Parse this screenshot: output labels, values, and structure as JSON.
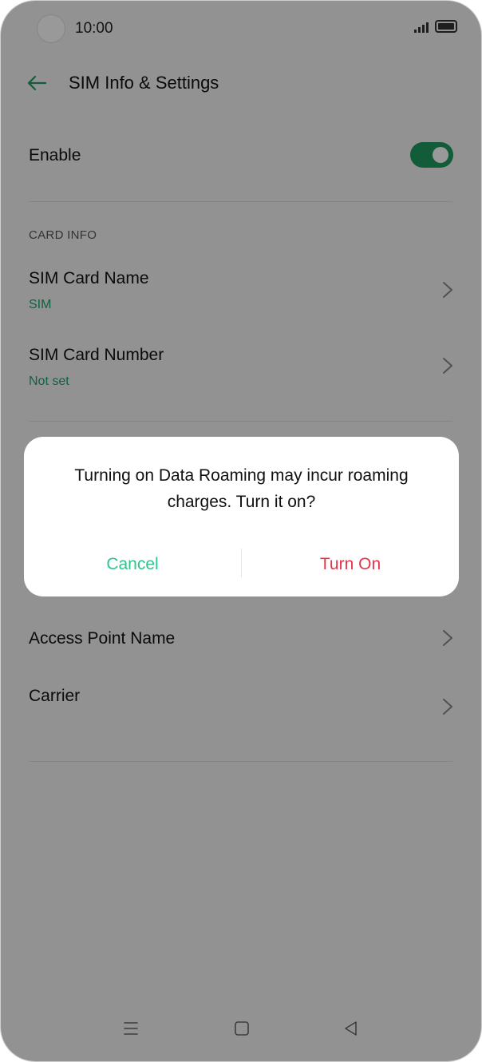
{
  "status_bar": {
    "time": "10:00"
  },
  "header": {
    "title": "SIM Info & Settings"
  },
  "enable_row": {
    "label": "Enable",
    "toggle_on": true
  },
  "card_info": {
    "section_label": "CARD INFO",
    "name_row": {
      "label": "SIM Card Name",
      "value": "SIM"
    },
    "number_row": {
      "label": "SIM Card Number",
      "value": "Not set"
    }
  },
  "network": {
    "apn_label": "Access Point Name",
    "carrier_label": "Carrier"
  },
  "dialog": {
    "message": "Turning on Data Roaming may incur roaming charges. Turn it on?",
    "cancel_label": "Cancel",
    "confirm_label": "Turn On"
  },
  "colors": {
    "accent_green": "#1aa36e",
    "confirm_red": "#e2344a",
    "toggle_green": "#1f9a5f"
  }
}
